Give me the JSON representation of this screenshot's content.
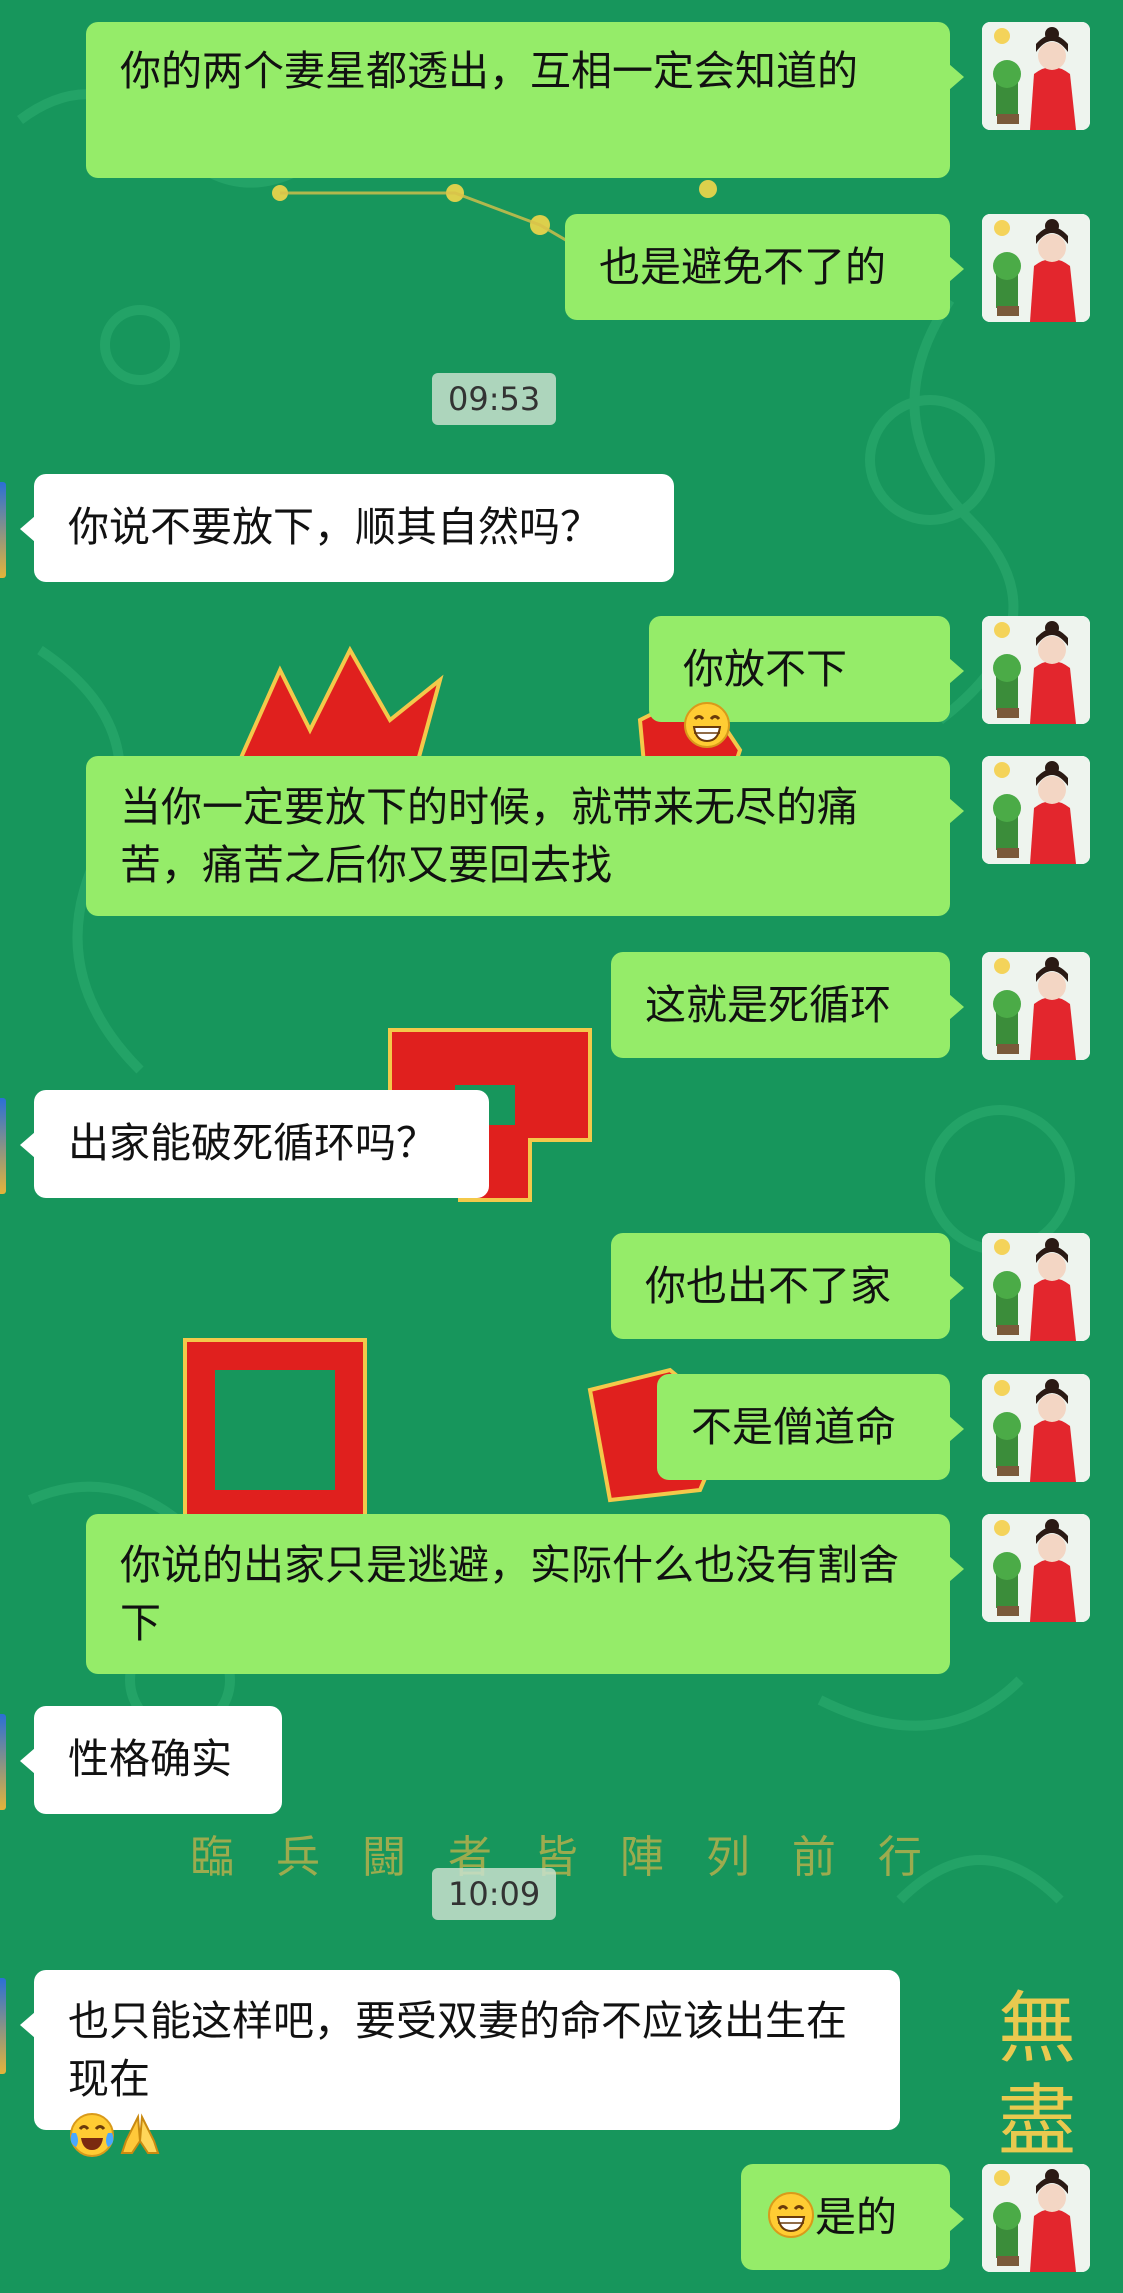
{
  "colors": {
    "background": "#17965c",
    "outgoing_bubble": "#95ec69",
    "incoming_bubble": "#ffffff",
    "seal_red": "#e0201e",
    "gold_text": "#c9b24a"
  },
  "background_art": {
    "watermark_text": "臨 兵 闘 者 皆 陣 列 前 行",
    "corner_glyphs": [
      "無",
      "盡"
    ]
  },
  "timestamps": [
    "09:53",
    "10:09"
  ],
  "messages": [
    {
      "side": "out",
      "text": "你的两个妻星都透出，互相一定会知道的"
    },
    {
      "side": "out",
      "text": "也是避免不了的"
    },
    {
      "side": "in",
      "text": "你说不要放下，顺其自然吗？"
    },
    {
      "side": "out",
      "text": "你放不下",
      "emoji_after": "grin-emoji"
    },
    {
      "side": "out",
      "text": "当你一定要放下的时候，就带来无尽的痛苦，痛苦之后你又要回去找"
    },
    {
      "side": "out",
      "text": "这就是死循环"
    },
    {
      "side": "in",
      "text": "出家能破死循环吗？"
    },
    {
      "side": "out",
      "text": "你也出不了家"
    },
    {
      "side": "out",
      "text": "不是僧道命"
    },
    {
      "side": "out",
      "text": "你说的出家只是逃避，实际什么也没有割舍下"
    },
    {
      "side": "in",
      "text": "性格确实"
    },
    {
      "side": "in",
      "text": "也只能这样吧，要受双妻的命不应该出生在现在",
      "emoji_after": "laugh-cry-emoji praying-hands-emoji"
    },
    {
      "side": "out",
      "text": "是的",
      "emoji_before": "grin-emoji"
    }
  ]
}
